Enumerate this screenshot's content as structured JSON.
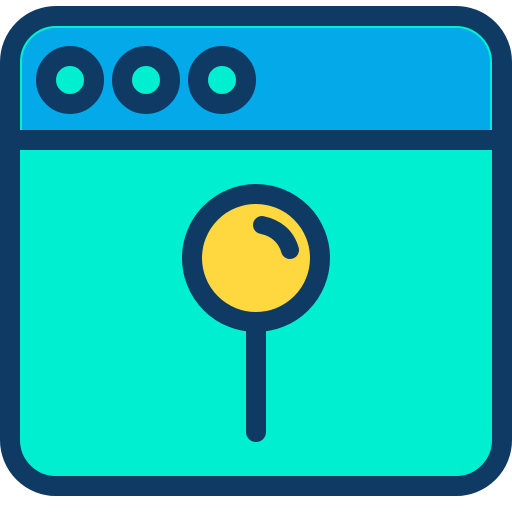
{
  "icon": {
    "name": "browser-window-location-pin",
    "window_dots": [
      "dot-1",
      "dot-2",
      "dot-3"
    ]
  },
  "colors": {
    "outline": "#0E3A63",
    "titlebar": "#04A9EA",
    "content": "#00EFD0",
    "dot_fill": "#00EFD0",
    "pin_head": "#FFD83F",
    "background": "#FFFFFF"
  }
}
